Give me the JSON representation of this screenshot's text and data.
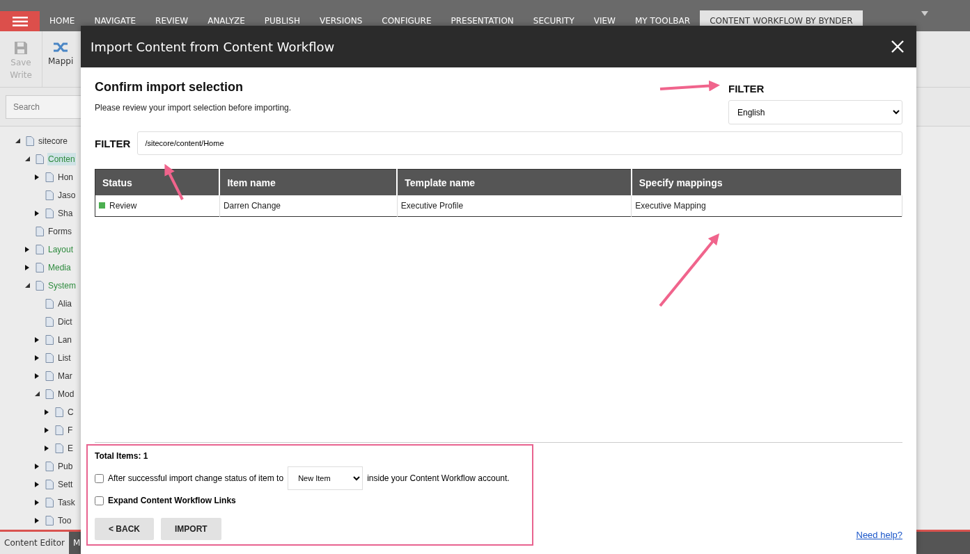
{
  "top_bar": {
    "tabs": [
      {
        "label": "HOME",
        "selected": false
      },
      {
        "label": "NAVIGATE",
        "selected": false
      },
      {
        "label": "REVIEW",
        "selected": false
      },
      {
        "label": "ANALYZE",
        "selected": false
      },
      {
        "label": "PUBLISH",
        "selected": false
      },
      {
        "label": "VERSIONS",
        "selected": false
      },
      {
        "label": "CONFIGURE",
        "selected": false
      },
      {
        "label": "PRESENTATION",
        "selected": false
      },
      {
        "label": "SECURITY",
        "selected": false
      },
      {
        "label": "VIEW",
        "selected": false
      },
      {
        "label": "MY TOOLBAR",
        "selected": false
      },
      {
        "label": "CONTENT WORKFLOW BY BYNDER",
        "selected": true
      }
    ]
  },
  "ribbon": {
    "buttons": [
      {
        "label": "Save",
        "disabled": true
      },
      {
        "label": "Mappi",
        "disabled": false
      }
    ],
    "group_label": "Write"
  },
  "search": {
    "placeholder": "Search"
  },
  "tree": [
    {
      "label": "sitecore",
      "expandable": true,
      "expanded": true,
      "selected": false,
      "children": [
        {
          "label": "Conten",
          "expandable": true,
          "expanded": true,
          "selected": true,
          "color": "#2e8b3e",
          "children": [
            {
              "label": "Hon",
              "expandable": true,
              "expanded": false,
              "selected": false
            },
            {
              "label": "Jaso",
              "expandable": false,
              "expanded": false,
              "selected": false
            },
            {
              "label": "Sha",
              "expandable": true,
              "expanded": false,
              "selected": false
            }
          ]
        },
        {
          "label": "Forms",
          "expandable": false,
          "expanded": false,
          "selected": false
        },
        {
          "label": "Layout",
          "expandable": true,
          "expanded": false,
          "selected": false,
          "color": "#2e8b3e"
        },
        {
          "label": "Media",
          "expandable": true,
          "expanded": false,
          "selected": false,
          "color": "#2e8b3e"
        },
        {
          "label": "System",
          "expandable": true,
          "expanded": true,
          "selected": false,
          "color": "#2e8b3e",
          "children": [
            {
              "label": "Alia",
              "expandable": false,
              "expanded": false,
              "selected": false
            },
            {
              "label": "Dict",
              "expandable": false,
              "expanded": false,
              "selected": false
            },
            {
              "label": "Lan",
              "expandable": true,
              "expanded": false,
              "selected": false
            },
            {
              "label": "List",
              "expandable": true,
              "expanded": false,
              "selected": false
            },
            {
              "label": "Mar",
              "expandable": true,
              "expanded": false,
              "selected": false
            },
            {
              "label": "Mod",
              "expandable": true,
              "expanded": true,
              "selected": false,
              "children": [
                {
                  "label": "C",
                  "expandable": true,
                  "expanded": false,
                  "selected": false
                },
                {
                  "label": "F",
                  "expandable": true,
                  "expanded": false,
                  "selected": false
                },
                {
                  "label": "E",
                  "expandable": true,
                  "expanded": false,
                  "selected": false
                }
              ]
            },
            {
              "label": "Pub",
              "expandable": true,
              "expanded": false,
              "selected": false
            },
            {
              "label": "Sett",
              "expandable": true,
              "expanded": false,
              "selected": false
            },
            {
              "label": "Task",
              "expandable": true,
              "expanded": false,
              "selected": false
            },
            {
              "label": "Too",
              "expandable": true,
              "expanded": false,
              "selected": false
            }
          ]
        }
      ]
    }
  ],
  "bottom_tabs": [
    {
      "label": "Content Editor",
      "selected": true
    },
    {
      "label": "M",
      "selected": false
    }
  ],
  "dialog": {
    "title": "Import Content from Content Workflow",
    "heading": "Confirm import selection",
    "description": "Please review your import selection before importing.",
    "language_filter": {
      "label": "FILTER",
      "value": "English"
    },
    "path_filter": {
      "label": "FILTER",
      "value": "/sitecore/content/Home"
    },
    "table": {
      "columns": [
        "Status",
        "Item name",
        "Template name",
        "Specify mappings"
      ],
      "rows": [
        {
          "status": "Review",
          "color": "#4caf50",
          "item_name": "Darren Change",
          "template_name": "Executive Profile",
          "mapping": "Executive Mapping"
        }
      ]
    },
    "footer": {
      "total": "Total Items: 1",
      "options": [
        {
          "kind": "status-change",
          "checked": false,
          "label_before": "After successful import change status of item to",
          "select_value": "New Item",
          "label_after": "inside your Content Workflow account."
        },
        {
          "kind": "plain",
          "checked": false,
          "label": "Expand Content Workflow Links"
        }
      ],
      "buttons": [
        "< BACK",
        "IMPORT"
      ],
      "help_link": "Need help?"
    }
  }
}
